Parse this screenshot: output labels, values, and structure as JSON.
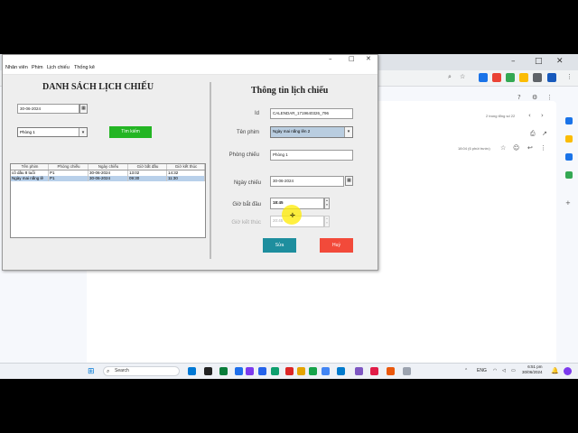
{
  "browser": {
    "ext_colors": [
      "#1a73e8",
      "#ea4335",
      "#34a853",
      "#fbbc04",
      "#5f6368",
      "#185abc",
      "#5f6368",
      "#1e8e3e"
    ],
    "mail_count": "2 trong tổng số 22",
    "mail_time": "18:04 (6 phút trước)",
    "rail_colors": [
      "#1a73e8",
      "#fbbc04",
      "#1a73e8",
      "#34a853"
    ]
  },
  "app": {
    "menu": [
      "Nhân viên",
      "Phim",
      "Lịch chiếu",
      "Thống kê"
    ],
    "left": {
      "title": "DANH SÁCH LỊCH CHIẾU",
      "date_value": "30-06-2024",
      "room_value": "Phòng 1",
      "search_label": "Tìm kiếm",
      "search_color": "#23b523",
      "table": {
        "headers": [
          "Tên phim",
          "Phòng chiếu",
          "Ngày chiếu",
          "Giờ bắt đầu",
          "Giờ kết thúc"
        ],
        "rows": [
          [
            "cô dâu 8 tuổi",
            "P1",
            "30-06-2024",
            "13:02",
            "14:32"
          ],
          [
            "Ngày mai nắng lê",
            "P1",
            "30-06-2024",
            "09:30",
            "11:30"
          ]
        ]
      }
    },
    "right": {
      "title": "Thông tin lịch chiếu",
      "id_label": "Id",
      "id_value": "CALENDAR_1719640326_796",
      "film_label": "Tên phim",
      "film_value": "Ngày mai nắng lên 2",
      "room_label": "Phòng chiếu",
      "room_value": "Phòng 1",
      "date_label": "Ngày chiếu",
      "date_value": "30-06-2024",
      "start_label": "Giờ bắt đầu",
      "start_value": "18:45",
      "end_label": "Giờ kết thúc",
      "end_value": "20:45",
      "edit_label": "Sửa",
      "edit_color": "#1e8e9e",
      "cancel_label": "Huỷ",
      "cancel_color": "#f24a3a"
    }
  },
  "taskbar": {
    "search_placeholder": "Search",
    "lang": "ENG",
    "time": "6:51 pm",
    "date": "30/06/2024",
    "icon_colors": [
      "#0078d4",
      "#222222",
      "#0a7d3b",
      "#1f6feb",
      "#7c3aed",
      "#2563eb",
      "#0e9f6e",
      "#dc2626",
      "#e5a400",
      "#16a34a",
      "#4285f4",
      "#007acc",
      "#7e57c2",
      "#e11d48",
      "#ea580c",
      "#9ca3af"
    ]
  }
}
